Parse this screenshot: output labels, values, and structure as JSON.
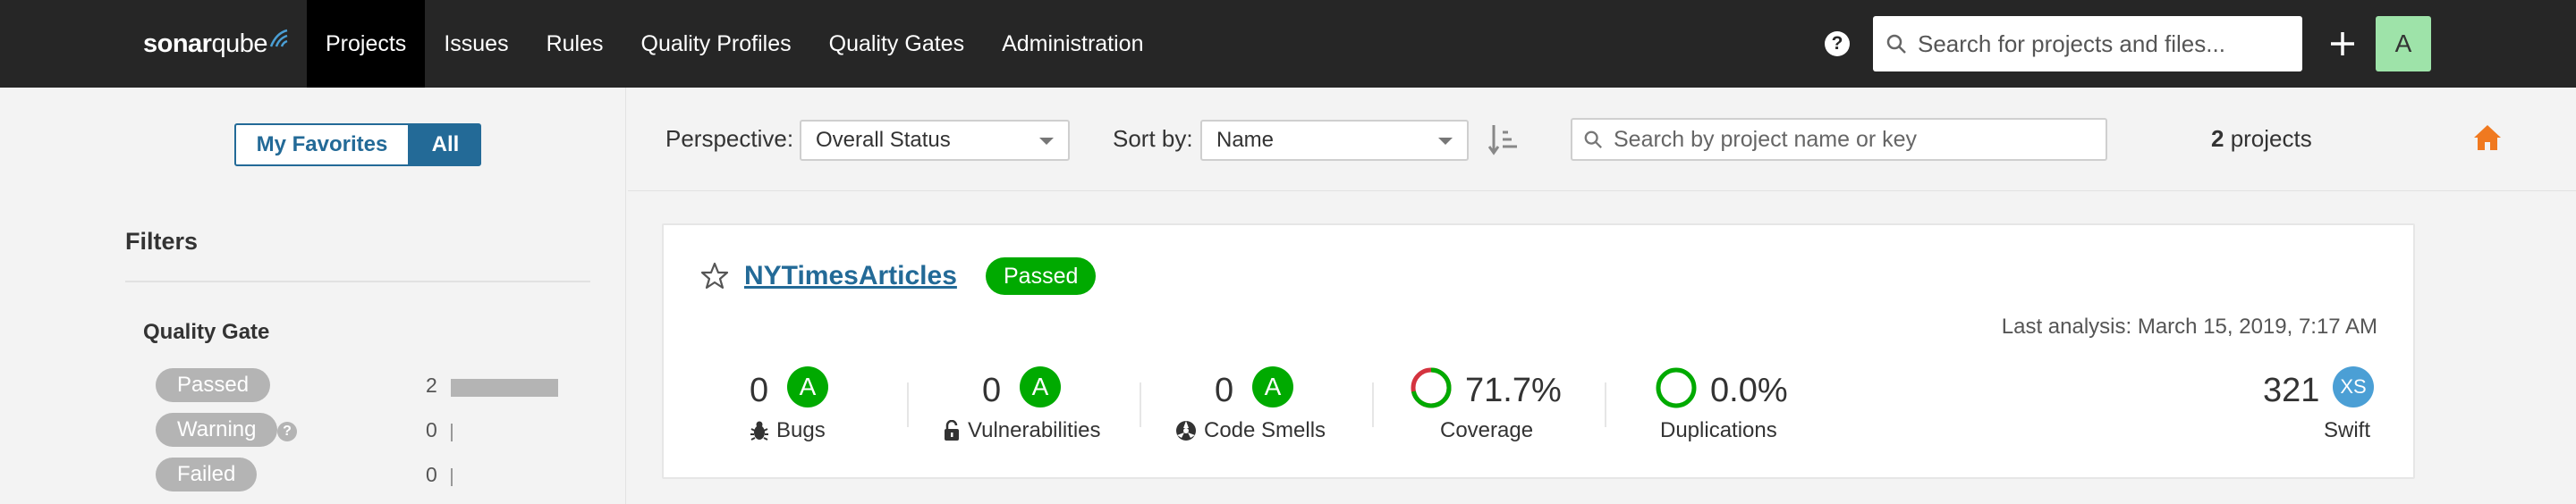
{
  "nav": {
    "logo_bold": "sonar",
    "logo_light": "qube",
    "links": [
      "Projects",
      "Issues",
      "Rules",
      "Quality Profiles",
      "Quality Gates",
      "Administration"
    ],
    "search_placeholder": "Search for projects and files...",
    "avatar_letter": "A"
  },
  "sidebar": {
    "toggle_my": "My Favorites",
    "toggle_all": "All",
    "filters_title": "Filters",
    "quality_gate_title": "Quality Gate",
    "quality_gate": [
      {
        "label": "Passed",
        "count": "2",
        "fraction": 1.0
      },
      {
        "label": "Warning",
        "count": "0",
        "fraction": 0
      },
      {
        "label": "Failed",
        "count": "0",
        "fraction": 0
      }
    ]
  },
  "toolbar": {
    "perspective_label": "Perspective:",
    "perspective_value": "Overall Status",
    "sort_label": "Sort by:",
    "sort_value": "Name",
    "search_placeholder": "Search by project name or key",
    "count_number": "2",
    "count_suffix": " projects"
  },
  "project": {
    "name": "NYTimesArticles",
    "status": "Passed",
    "last_analysis": "Last analysis: March 15, 2019, 7:17 AM",
    "bugs_value": "0",
    "bugs_rating": "A",
    "bugs_label": "Bugs",
    "vuln_value": "0",
    "vuln_rating": "A",
    "vuln_label": "Vulnerabilities",
    "smells_value": "0",
    "smells_rating": "A",
    "smells_label": "Code Smells",
    "coverage_value": "71.7%",
    "coverage_label": "Coverage",
    "coverage_fraction": 0.717,
    "dup_value": "0.0%",
    "dup_label": "Duplications",
    "loc_value": "321",
    "size_rating": "XS",
    "language": "Swift"
  },
  "colors": {
    "nav_bg": "#262626",
    "accent_blue": "#236a97",
    "passed_green": "#00aa00",
    "home_orange": "#f0791f",
    "coverage_red": "#d4333f"
  }
}
